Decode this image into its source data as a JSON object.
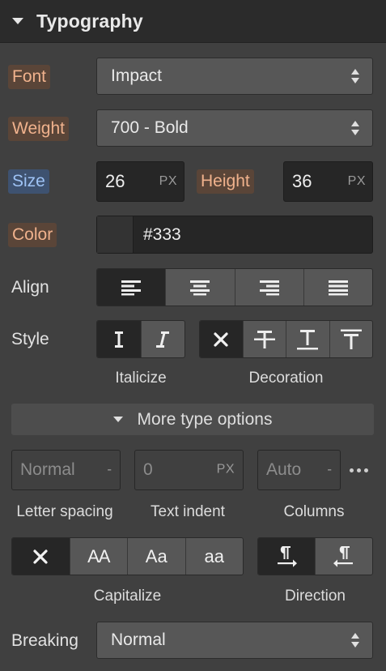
{
  "header": {
    "title": "Typography"
  },
  "font": {
    "label": "Font",
    "value": "Impact"
  },
  "weight": {
    "label": "Weight",
    "value": "700 - Bold"
  },
  "size": {
    "label": "Size",
    "value": "26",
    "unit": "PX"
  },
  "height": {
    "label": "Height",
    "value": "36",
    "unit": "PX"
  },
  "color": {
    "label": "Color",
    "value": "#333",
    "swatch": "#333333"
  },
  "align": {
    "label": "Align",
    "selected": "left",
    "options": [
      "left",
      "center",
      "right",
      "justify"
    ]
  },
  "style": {
    "label": "Style",
    "italicize_caption": "Italicize",
    "decoration_caption": "Decoration",
    "italic_selected": "regular",
    "decoration_selected": "none"
  },
  "more": {
    "label": "More type options"
  },
  "letter_spacing": {
    "placeholder": "Normal",
    "unit": "-",
    "caption": "Letter spacing"
  },
  "text_indent": {
    "placeholder": "0",
    "unit": "PX",
    "caption": "Text indent"
  },
  "columns": {
    "placeholder": "Auto",
    "unit": "-",
    "caption": "Columns"
  },
  "capitalize": {
    "caption": "Capitalize",
    "selected": "none",
    "options": {
      "upper": "AA",
      "title": "Aa",
      "lower": "aa"
    }
  },
  "direction": {
    "caption": "Direction",
    "selected": "ltr"
  },
  "breaking": {
    "label": "Breaking",
    "value": "Normal"
  },
  "colors": {
    "accent_orange": "#f0b28d",
    "accent_blue": "#9ec3f5"
  }
}
